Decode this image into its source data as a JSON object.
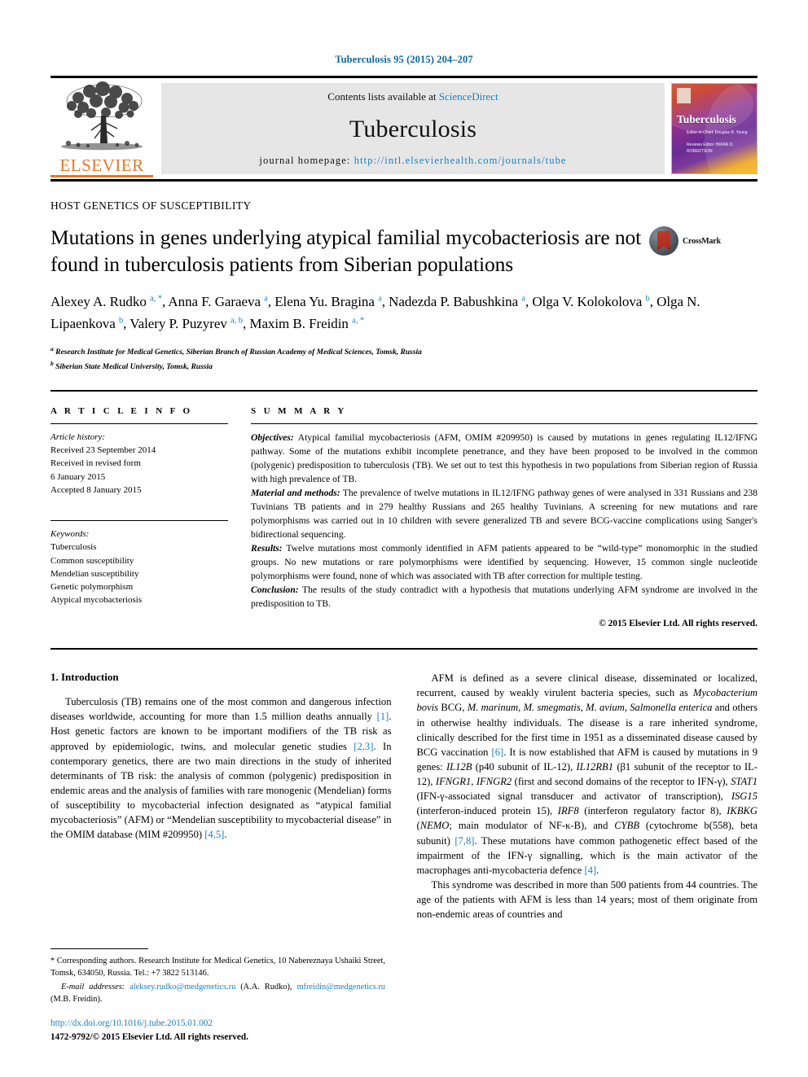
{
  "running_head": "Tuberculosis 95 (2015) 204–207",
  "masthead": {
    "publisher_name": "ELSEVIER",
    "contents_prefix": "Contents lists available at ",
    "contents_link": "ScienceDirect",
    "journal_name": "Tuberculosis",
    "homepage_prefix": "journal homepage: ",
    "homepage_url": "http://intl.elsevierhealth.com/journals/tube",
    "cover": {
      "title": "Tuberculosis",
      "sub1": "Editor-in-Chief:\nDouglas B. Young",
      "sub2": "Reviews Editor:\nBRIAN D. ROBERTSON"
    }
  },
  "article": {
    "section_label": "HOST GENETICS OF SUSCEPTIBILITY",
    "title": "Mutations in genes underlying atypical familial mycobacteriosis are not found in tuberculosis patients from Siberian populations",
    "crossmark_label": "CrossMark",
    "authors": [
      {
        "name": "Alexey A. Rudko",
        "sup": "a, *"
      },
      {
        "name": "Anna F. Garaeva",
        "sup": "a"
      },
      {
        "name": "Elena Yu. Bragina",
        "sup": "a"
      },
      {
        "name": "Nadezda P. Babushkina",
        "sup": "a"
      },
      {
        "name": "Olga V. Kolokolova",
        "sup": "b"
      },
      {
        "name": "Olga N. Lipaenkova",
        "sup": "b"
      },
      {
        "name": "Valery P. Puzyrev",
        "sup": "a, b"
      },
      {
        "name": "Maxim B. Freidin",
        "sup": "a, *"
      }
    ],
    "affiliations": [
      {
        "mark": "a",
        "text": "Research Institute for Medical Genetics, Siberian Branch of Russian Academy of Medical Sciences, Tomsk, Russia"
      },
      {
        "mark": "b",
        "text": "Siberian State Medical University, Tomsk, Russia"
      }
    ]
  },
  "article_info": {
    "heading": "A R T I C L E   I N F O",
    "history_label": "Article history:",
    "history": [
      "Received 23 September 2014",
      "Received in revised form",
      "6 January 2015",
      "Accepted 8 January 2015"
    ],
    "keywords_label": "Keywords:",
    "keywords": [
      "Tuberculosis",
      "Common susceptibility",
      "Mendelian susceptibility",
      "Genetic polymorphism",
      "Atypical mycobacteriosis"
    ]
  },
  "summary": {
    "heading": "S U M M A R Y",
    "paragraphs": [
      {
        "lead": "Objectives:",
        "text": " Atypical familial mycobacteriosis (AFM, OMIM #209950) is caused by mutations in genes regulating IL12/IFNG pathway. Some of the mutations exhibit incomplete penetrance, and they have been proposed to be involved in the common (polygenic) predisposition to tuberculosis (TB). We set out to test this hypothesis in two populations from Siberian region of Russia with high prevalence of TB."
      },
      {
        "lead": "Material and methods:",
        "text": " The prevalence of twelve mutations in IL12/IFNG pathway genes of were analysed in 331 Russians and 238 Tuvinians TB patients and in 279 healthy Russians and 265 healthy Tuvinians. A screening for new mutations and rare polymorphisms was carried out in 10 children with severe generalized TB and severe BCG-vaccine complications using Sanger's bidirectional sequencing."
      },
      {
        "lead": "Results:",
        "text": " Twelve mutations most commonly identified in AFM patients appeared to be “wild-type” monomorphic in the studied groups. No new mutations or rare polymorphisms were identified by sequencing. However, 15 common single nucleotide polymorphisms were found, none of which was associated with TB after correction for multiple testing."
      },
      {
        "lead": "Conclusion:",
        "text": " The results of the study contradict with a hypothesis that mutations underlying AFM syndrome are involved in the predisposition to TB."
      }
    ],
    "copyright": "© 2015 Elsevier Ltd. All rights reserved."
  },
  "body": {
    "intro_heading": "1.  Introduction",
    "left_paragraph_1": "Tuberculosis (TB) remains one of the most common and dangerous infection diseases worldwide, accounting for more than 1.5 million deaths annually [1]. Host genetic factors are known to be important modifiers of the TB risk as approved by epidemiologic, twins, and molecular genetic studies [2,3]. In contemporary genetics, there are two main directions in the study of inherited determinants of TB risk: the analysis of common (polygenic) predisposition in endemic areas and the analysis of families with rare monogenic (Mendelian) forms of susceptibility to mycobacterial infection designated as “atypical familial mycobacteriosis” (AFM) or “Mendelian susceptibility to mycobacterial disease” in the OMIM database (MIM #209950) [4,5].",
    "right_paragraph_1": "AFM is defined as a severe clinical disease, disseminated or localized, recurrent, caused by weakly virulent bacteria species, such as Mycobacterium bovis BCG, M. marinum, M. smegmatis, M. avium, Salmonella enterica and others in otherwise healthy individuals. The disease is a rare inherited syndrome, clinically described for the first time in 1951 as a disseminated disease caused by BCG vaccination [6]. It is now established that AFM is caused by mutations in 9 genes: IL12B (p40 subunit of IL-12), IL12RB1 (β1 subunit of the receptor to IL-12), IFNGR1, IFNGR2 (first and second domains of the receptor to IFN-γ), STAT1 (IFN-γ-associated signal transducer and activator of transcription), ISG15 (interferon-induced protein 15), IRF8 (interferon regulatory factor 8), IKBKG (NEMO; main modulator of NF-κ-B), and CYBB (cytochrome b(558), beta subunit) [7,8]. These mutations have common pathogenetic effect based of the impairment of the IFN-γ signalling, which is the main activator of the macrophages anti-mycobacteria defence [4].",
    "right_paragraph_2": "This syndrome was described in more than 500 patients from 44 countries. The age of the patients with AFM is less than 14 years; most of them originate from non-endemic areas of countries and"
  },
  "footnotes": {
    "corresponding": "Corresponding authors. Research Institute for Medical Genetics, 10 Nabereznaya Ushaiki Street, Tomsk, 634050, Russia. Tel.: +7 3822 513146.",
    "email_label": "E-mail addresses:",
    "email_1": "aleksey.rudko@medgenetics.ru",
    "email_1_owner": "(A.A. Rudko),",
    "email_2": "mfreidin@medgenetics.ru",
    "email_2_owner": "(M.B. Freidin).",
    "doi": "http://dx.doi.org/10.1016/j.tube.2015.01.002",
    "issn_line": "1472-9792/© 2015 Elsevier Ltd. All rights reserved."
  },
  "colors": {
    "link": "#1a7fc1",
    "elsevier_orange": "#E87722",
    "running_head": "#0b6a9e"
  }
}
